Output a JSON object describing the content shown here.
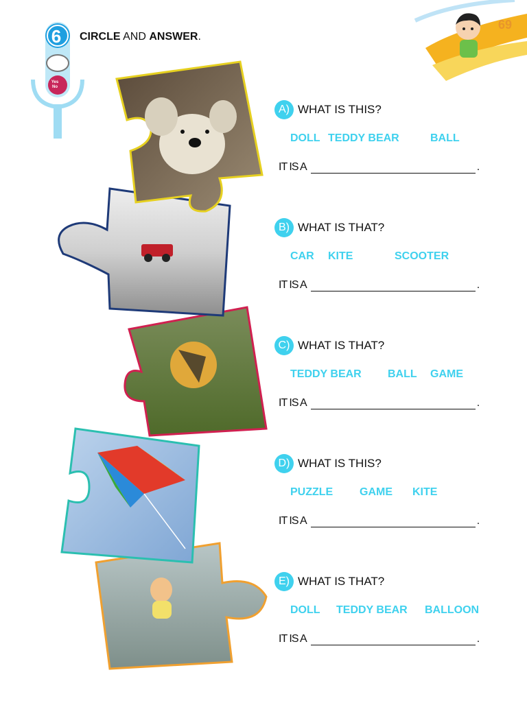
{
  "page_number": "69",
  "lesson_number": "6",
  "instruction": {
    "word1": "CIRCLE",
    "word2": "AND",
    "word3": "ANSWER",
    "end": "."
  },
  "badge": {
    "yes": "Yes",
    "no": "No"
  },
  "answer_prefix": "IT IS A",
  "questions": [
    {
      "letter": "A)",
      "text": "WHAT IS THIS?",
      "options": [
        "DOLL",
        "TEDDY BEAR",
        "BALL"
      ]
    },
    {
      "letter": "B)",
      "text": "WHAT IS THAT?",
      "options": [
        "CAR",
        "KITE",
        "SCOOTER"
      ]
    },
    {
      "letter": "C)",
      "text": "WHAT IS THAT?",
      "options": [
        "TEDDY BEAR",
        "BALL",
        "GAME"
      ]
    },
    {
      "letter": "D)",
      "text": "WHAT IS THIS?",
      "options": [
        "PUZZLE",
        "GAME",
        "KITE"
      ]
    },
    {
      "letter": "E)",
      "text": "WHAT IS THAT?",
      "options": [
        "DOLL",
        "TEDDY BEAR",
        "BALLOON"
      ]
    }
  ]
}
